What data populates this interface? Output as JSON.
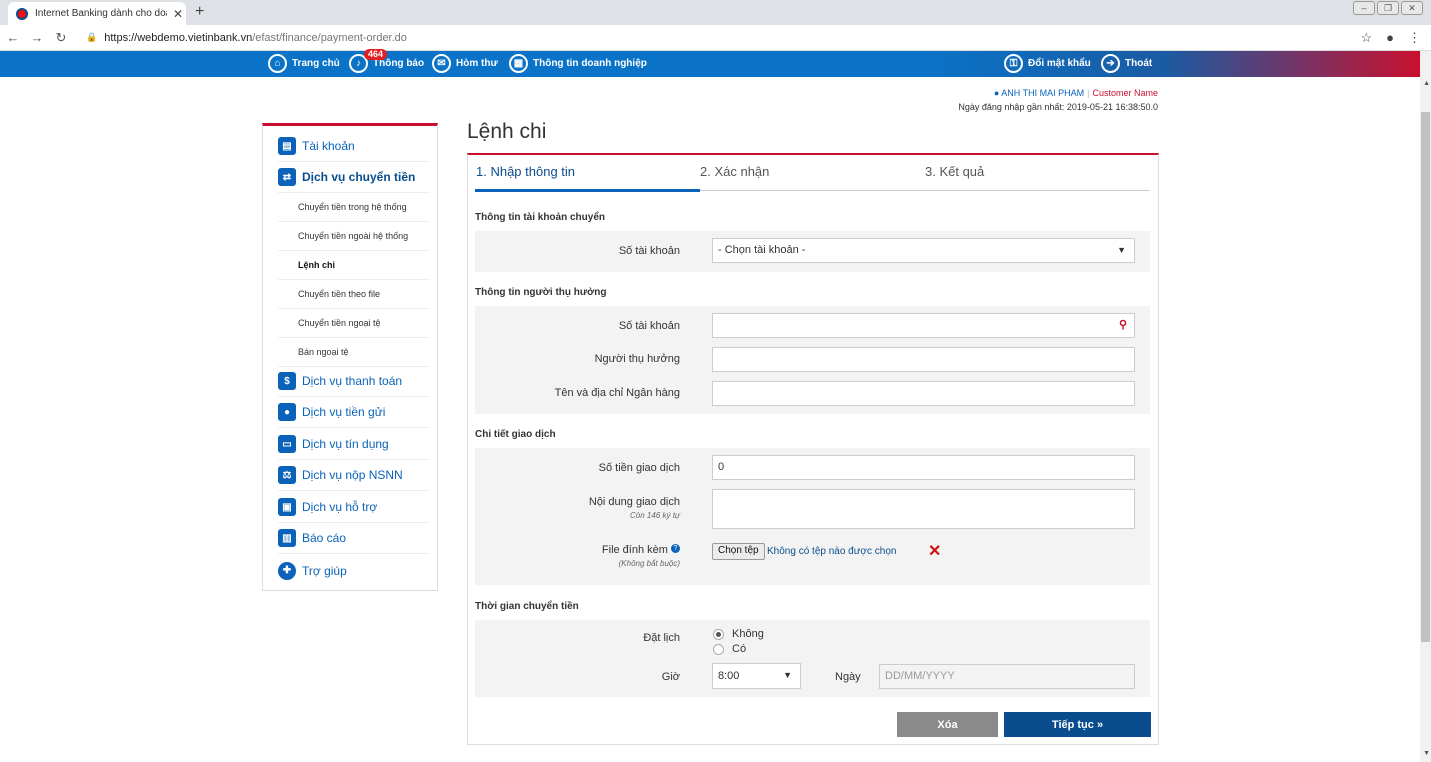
{
  "browser": {
    "tab_title": "Internet Banking dành cho doanh",
    "url_host": "https://webdemo.vietinbank.vn",
    "url_path": "/efast/finance/payment-order.do"
  },
  "topnav": {
    "home": "Trang chủ",
    "notifications": "Thông báo",
    "notifications_badge": "464",
    "mailbox": "Hòm thư",
    "company_info": "Thông tin doanh nghiệp",
    "change_password": "Đổi mật khẩu",
    "logout": "Thoát"
  },
  "user": {
    "name": "ANH THI MAI PHAM",
    "customer_name": "Customer Name",
    "last_login": "Ngày đăng nhập gần nhất: 2019-05-21 16:38:50.0"
  },
  "sidebar": {
    "account": "Tài khoản",
    "transfer": "Dịch vụ chuyển tiền",
    "sub": [
      "Chuyển tiền trong hệ thống",
      "Chuyển tiền ngoài hệ thống",
      "Lệnh chi",
      "Chuyển tiền theo file",
      "Chuyển tiền ngoại tệ",
      "Bán ngoại tệ"
    ],
    "payment": "Dịch vụ thanh toán",
    "deposit": "Dịch vụ tiền gửi",
    "credit": "Dịch vụ tín dụng",
    "tax": "Dịch vụ nộp NSNN",
    "support": "Dịch vụ hỗ trợ",
    "report": "Báo cáo",
    "help": "Trợ giúp"
  },
  "page": {
    "title": "Lệnh chi",
    "steps": [
      "1. Nhập thông tin",
      "2. Xác nhận",
      "3. Kết quả"
    ]
  },
  "from_account": {
    "title": "Thông tin tài khoản chuyển",
    "account_label": "Số tài khoản",
    "account_value": "- Chọn tài khoản -"
  },
  "beneficiary": {
    "title": "Thông tin người thụ hưởng",
    "account_label": "Số tài khoản",
    "account_value": "",
    "name_label": "Người thụ hưởng",
    "name_value": "",
    "bank_label": "Tên và địa chỉ Ngân hàng",
    "bank_value": ""
  },
  "details": {
    "title": "Chi tiết giao dịch",
    "amount_label": "Số tiền giao dịch",
    "amount_value": "0",
    "content_label": "Nội dung giao dịch",
    "content_note": "Còn 146 ký tự",
    "content_value": "",
    "file_label": "File đính kèm",
    "file_note": "(Không bắt buộc)",
    "file_button": "Chọn tệp",
    "file_status": "Không có tệp nào được chọn"
  },
  "schedule": {
    "title": "Thời gian chuyển tiền",
    "schedule_label": "Đặt lịch",
    "option_no": "Không",
    "option_yes": "Có",
    "hour_label": "Giờ",
    "hour_value": "8:00",
    "date_label": "Ngày",
    "date_placeholder": "DD/MM/YYYY"
  },
  "actions": {
    "clear": "Xóa",
    "next": "Tiếp tục »"
  }
}
